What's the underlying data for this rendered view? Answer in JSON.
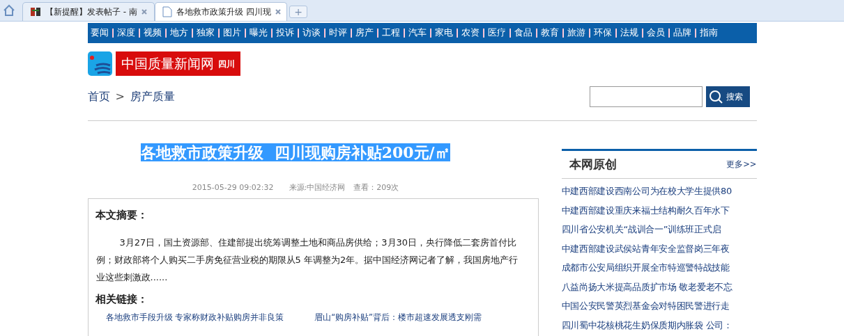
{
  "browser": {
    "tabs": [
      {
        "title": "【新提醒】发表帖子 - 南",
        "selected": false,
        "kind": "favicon"
      },
      {
        "title": "各地救市政策升级 四川现",
        "selected": true,
        "kind": "page"
      }
    ],
    "new_tab": "+"
  },
  "nav": [
    "要闻",
    "深度",
    "视频",
    "地方",
    "独家",
    "图片",
    "曝光",
    "投诉",
    "访谈",
    "时评",
    "房产",
    "工程",
    "汽车",
    "家电",
    "农资",
    "医疗",
    "食品",
    "教育",
    "旅游",
    "环保",
    "法规",
    "会员",
    "品牌",
    "指南"
  ],
  "logo": {
    "name": "中国质量新闻网",
    "region": "四川"
  },
  "breadcrumb": {
    "home": "首页",
    "separator": ">",
    "current": "房产质量"
  },
  "search": {
    "button": "搜索"
  },
  "article": {
    "title": "各地救市政策升级  四川现购房补贴200元/㎡",
    "title_selected": true,
    "date": "2015-05-29 09:02:32",
    "source": "来源:中国经济网",
    "views": "查看：209次",
    "summary_heading": "本文摘要：",
    "summary": "3月27日，国土资源部、住建部提出统筹调整土地和商品房供给；3月30日，央行降低二套房首付比例；财政部将个人购买二手房免征营业税的期限从5 年调整为2年。据中国经济网记者了解，我国房地产行业这些刺激政......",
    "links_heading": "相关链接：",
    "links": [
      "各地救市手段升级 专家称财政补贴购房并非良策",
      "眉山“购房补贴”背后：楼市超速发展透支刚需"
    ]
  },
  "sidebar": {
    "title": "本网原创",
    "more": "更多>>",
    "items": [
      "中建西部建设西南公司为在校大学生提供80",
      "中建西部建设重庆来福士结构耐久百年水下",
      "四川省公安机关“战训合一”训练班正式启",
      "中建西部建设武侯站青年安全监督岗三年夜",
      "成都市公安局组织开展全市特巡警特战技能",
      "八益尚扬大米提高品质扩市场  敬老爱老不忘",
      "中国公安民警英烈基金会对特困民警进行走",
      "四川蜀中花核桃花生奶保质期内胀袋  公司："
    ]
  }
}
